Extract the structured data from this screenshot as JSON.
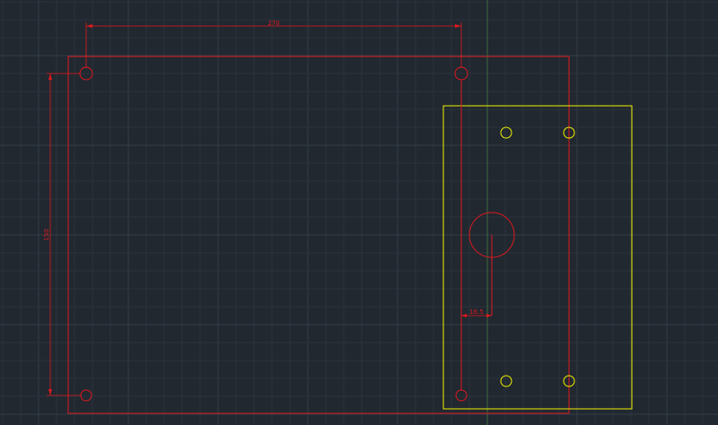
{
  "colors": {
    "background": "#212830",
    "grid_minor": "#2a323b",
    "grid_major": "#343d47",
    "axis_y": "#3e6a3c",
    "axis_x": "#6a3c3c",
    "red_entity": "#e0181e",
    "yellow_entity": "#f0f000",
    "dimension": "#e0181e"
  },
  "drawing": {
    "dimensions": {
      "horizontal_label": "270",
      "vertical_label": "150",
      "offset_label": "16.5"
    }
  }
}
